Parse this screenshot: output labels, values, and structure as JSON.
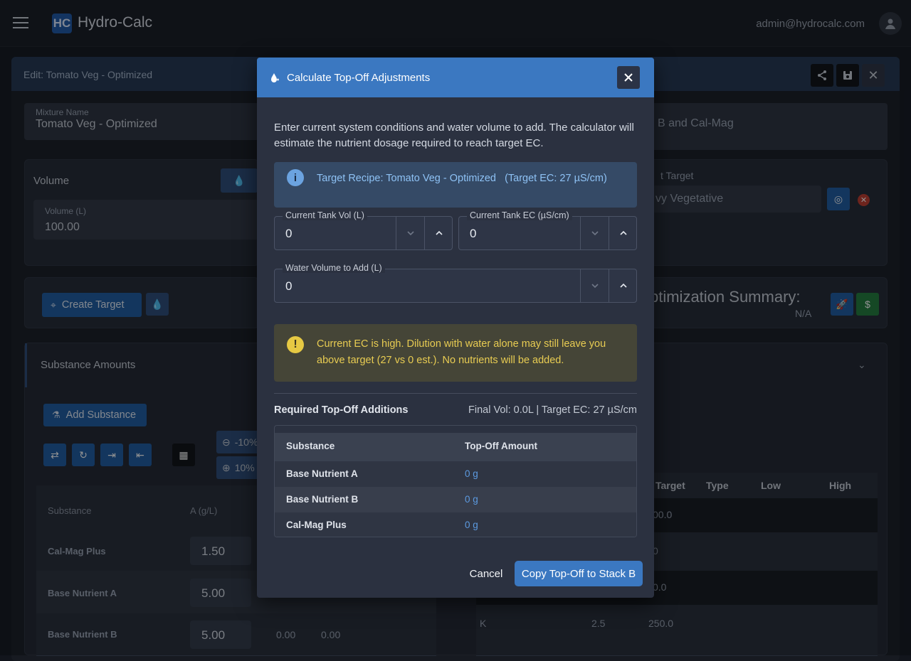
{
  "header": {
    "logo_text": "HC",
    "brand": "Hydro-Calc",
    "user_email": "admin@hydrocalc.com"
  },
  "background": {
    "edit_title": "Edit: Tomato Veg - Optimized",
    "mixture_name_label": "Mixture Name",
    "mixture_name_value": "Tomato Veg - Optimized",
    "description_fragment": "B and Cal-Mag",
    "volume_title": "Volume",
    "volume_label": "Volume (L)",
    "volume_value": "100.00",
    "target_label_fragment": "t Target",
    "target_value_fragment": "vy Vegetative",
    "create_target_label": "Create Target",
    "opt_summary_fragment": "ptimization Summary:",
    "opt_summary_value": "N/A",
    "substance_amounts_title": "Substance Amounts",
    "add_substance_label": "Add Substance",
    "pct_minus": "-10%",
    "pct_plus": "10%",
    "substances_table": {
      "headers": [
        "Substance",
        "A (g/L)"
      ],
      "rows": [
        {
          "name": "Cal-Mag Plus",
          "value": "1.50"
        },
        {
          "name": "Base Nutrient A",
          "value": "5.00"
        },
        {
          "name": "Base Nutrient B",
          "value": "5.00",
          "extra1": "0.00",
          "extra2": "0.00"
        }
      ]
    },
    "targets_table": {
      "headers": [
        "Target",
        "Type",
        "Low",
        "High"
      ],
      "rows": [
        {
          "element": "",
          "value": "",
          "target": "00.0"
        },
        {
          "element": "",
          "value": "",
          "target": "0"
        },
        {
          "element": "",
          "value": "",
          "target": "0.0"
        },
        {
          "element": "K",
          "value": "2.5",
          "target": "250.0"
        }
      ]
    }
  },
  "modal": {
    "title": "Calculate Top-Off Adjustments",
    "intro": "Enter current system conditions and water volume to add. The calculator will estimate the nutrient dosage required to reach target EC.",
    "info_text": "Target Recipe: Tomato Veg - Optimized   (Target EC: 27 µS/cm)",
    "fields": {
      "tank_vol": {
        "label": "Current Tank Vol (L)",
        "value": "0"
      },
      "tank_ec": {
        "label": "Current Tank EC (µS/cm)",
        "value": "0"
      },
      "water_add": {
        "label": "Water Volume to Add (L)",
        "value": "0"
      }
    },
    "warning": "Current EC is high. Dilution with water alone may still leave you above target (27 vs 0 est.). No nutrients will be added.",
    "required_title": "Required Top-Off Additions",
    "required_summary": "Final Vol: 0.0L | Target EC: 27 µS/cm",
    "table": {
      "headers": [
        "Substance",
        "Top-Off Amount"
      ],
      "rows": [
        {
          "substance": "Base Nutrient A",
          "amount": "0 g"
        },
        {
          "substance": "Base Nutrient B",
          "amount": "0 g"
        },
        {
          "substance": "Cal-Mag Plus",
          "amount": "0 g"
        }
      ]
    },
    "cancel_label": "Cancel",
    "copy_label": "Copy Top-Off to Stack B"
  },
  "colors": {
    "accent": "#3b78c1",
    "info_text": "#8ec2f5",
    "warning_text": "#e8cc52",
    "amount_text": "#5c9ae0"
  }
}
